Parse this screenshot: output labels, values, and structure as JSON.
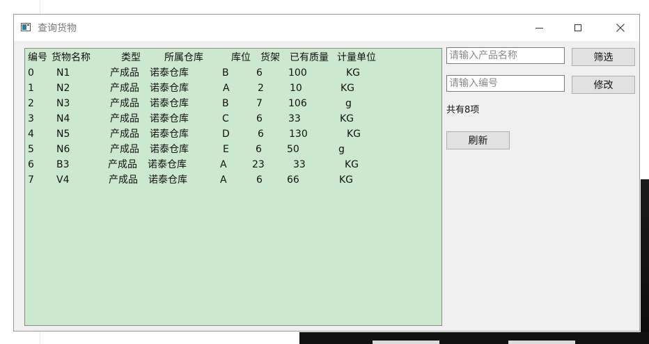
{
  "window": {
    "title": "查询货物"
  },
  "table": {
    "headers": [
      "编号",
      "货物名称",
      "类型",
      "所属仓库",
      "库位",
      "货架",
      "已有质量",
      "计量单位"
    ],
    "rows": [
      [
        "0",
        "N1",
        "产成品",
        "诺泰仓库",
        "B",
        "6",
        "100",
        "KG"
      ],
      [
        "1",
        "N2",
        "产成品",
        "诺泰仓库",
        "A",
        "2",
        "10",
        "KG"
      ],
      [
        "2",
        "N3",
        "产成品",
        "诺泰仓库",
        "B",
        "7",
        "106",
        "g"
      ],
      [
        "3",
        "N4",
        "产成品",
        "诺泰仓库",
        "C",
        "6",
        "33",
        "KG"
      ],
      [
        "4",
        "N5",
        "产成品",
        "诺泰仓库",
        "D",
        "6",
        "130",
        "KG"
      ],
      [
        "5",
        "N6",
        "产成品",
        "诺泰仓库",
        "E",
        "6",
        "50",
        "g"
      ],
      [
        "6",
        "B3",
        "产成品",
        "诺泰仓库",
        "A",
        "23",
        "33",
        "KG"
      ],
      [
        "7",
        "V4",
        "产成品",
        "诺泰仓库",
        "A",
        "6",
        "66",
        "KG"
      ]
    ]
  },
  "controls": {
    "product_name_placeholder": "请输入产品名称",
    "filter_button": "筛选",
    "id_placeholder": "请输入编号",
    "modify_button": "修改",
    "count_text": "共有8项",
    "refresh_button": "刷新"
  },
  "colors": {
    "list_background": "#cce8cf",
    "window_background": "#f0f0f0"
  }
}
